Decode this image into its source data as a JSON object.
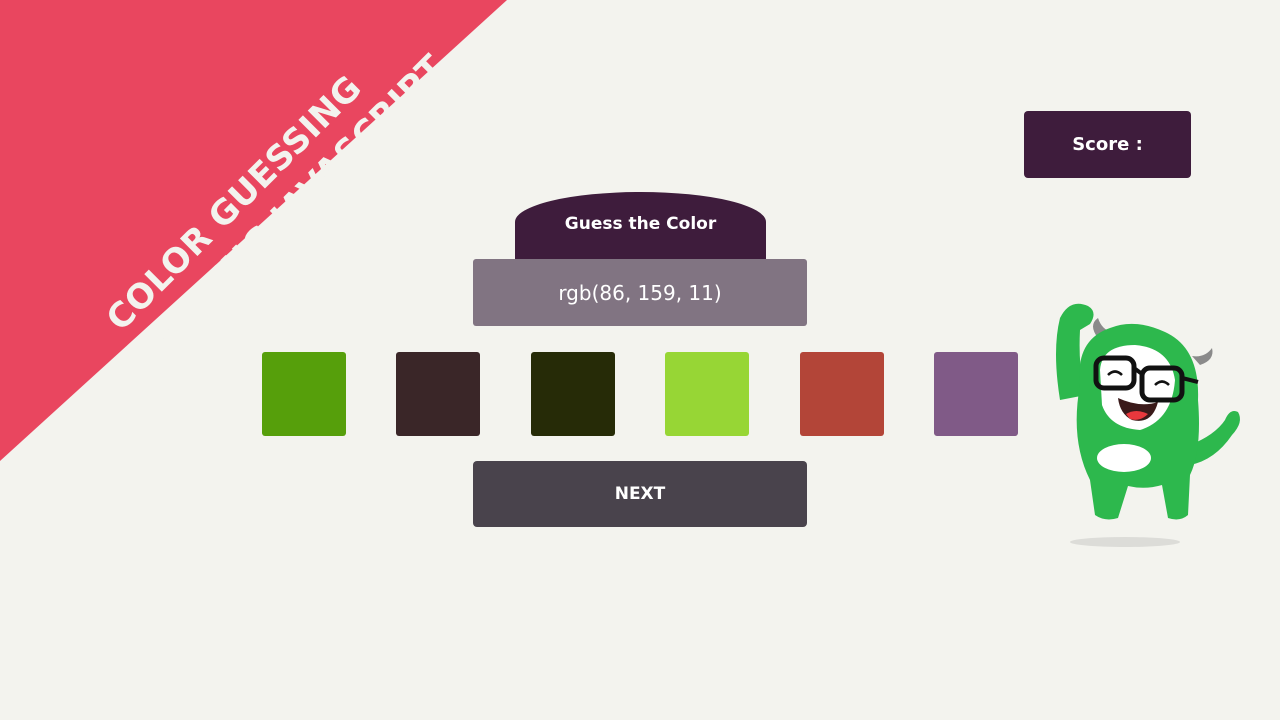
{
  "banner": {
    "line1": "COLOR GUESSING",
    "line2": "GAME USING JAVASCRIPT",
    "color": "#e9465f"
  },
  "score": {
    "label": "Score :"
  },
  "game": {
    "title": "Guess the Color",
    "target_rgb": "rgb(86, 159, 11)",
    "swatches": [
      {
        "color": "#569f0b"
      },
      {
        "color": "#3a2628"
      },
      {
        "color": "#262b07"
      },
      {
        "color": "#97d635"
      },
      {
        "color": "#b34538"
      },
      {
        "color": "#805a87"
      }
    ],
    "next_label": "NEXT"
  },
  "mascot": {
    "icon": "green-monster-mascot-icon",
    "body_color": "#2db84d"
  }
}
